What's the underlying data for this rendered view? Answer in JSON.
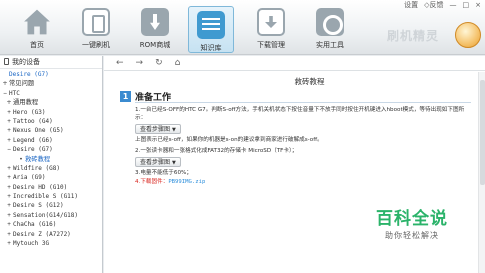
{
  "window_controls": {
    "settings": "设置",
    "feedback": "◇反馈",
    "minimize": "—",
    "maximize": "□",
    "close": "×"
  },
  "toolbar": {
    "items": [
      {
        "label": "首页",
        "icon": "home-icon"
      },
      {
        "label": "一键刷机",
        "icon": "flash-icon"
      },
      {
        "label": "ROM商城",
        "icon": "rom-download-icon"
      },
      {
        "label": "知识库",
        "icon": "knowledge-icon",
        "active": true
      },
      {
        "label": "下载管理",
        "icon": "download-manager-icon"
      },
      {
        "label": "实用工具",
        "icon": "tools-icon"
      }
    ],
    "brand": "刷机精灵"
  },
  "sidebar": {
    "header": "我的设备",
    "items": [
      {
        "toggle": "",
        "label": "Desire (G7)"
      },
      {
        "toggle": "+",
        "label": "常见问题"
      },
      {
        "toggle": "−",
        "label": "HTC"
      },
      {
        "toggle": "+",
        "label": "通用教程"
      },
      {
        "toggle": "+",
        "label": "Hero (G3)"
      },
      {
        "toggle": "+",
        "label": "Tattoo (G4)"
      },
      {
        "toggle": "+",
        "label": "Nexus One (G5)"
      },
      {
        "toggle": "+",
        "label": "Legend (G6)"
      },
      {
        "toggle": "−",
        "label": "Desire (G7)"
      },
      {
        "toggle": "•",
        "label": "救砖教程"
      },
      {
        "toggle": "+",
        "label": "Wildfire (G8)"
      },
      {
        "toggle": "+",
        "label": "Aria (G9)"
      },
      {
        "toggle": "+",
        "label": "Desire HD (G10)"
      },
      {
        "toggle": "+",
        "label": "Incredible S (G11)"
      },
      {
        "toggle": "+",
        "label": "Desire S (G12)"
      },
      {
        "toggle": "+",
        "label": "Sensation(G14/G18)"
      },
      {
        "toggle": "+",
        "label": "ChaCha (G16)"
      },
      {
        "toggle": "+",
        "label": "Desire Z (A7272)"
      },
      {
        "toggle": "+",
        "label": "Mytouch 3G"
      }
    ]
  },
  "nav": {
    "back": "←",
    "forward": "→",
    "refresh": "↻",
    "home": "⌂"
  },
  "article": {
    "title": "救砖教程",
    "section_num": "1",
    "section_title": "准备工作",
    "p1": "1.一台已经S-OFF的HTC G7。判断S-off方法，手机关机状态下按住音量下不放手同时按住开机键进入hboot模式，等待出现如下图所示：",
    "btn1": "查看步骤图",
    "p2": "上图表示已经s-off，如果你的机器是s-on的建议拿到商家进行破解成s-off。",
    "p3": "2.一张读卡器和一张格式化成FAT32的存储卡 MicroSD（TF卡）；",
    "btn2": "查看步骤图",
    "p4": "3.电量不能低于60%；",
    "p5_label": "4.下载固件：",
    "p5_link": "PB99IMG.zip"
  },
  "watermark": {
    "main": "百科全说",
    "sub": "助你轻松解决"
  }
}
